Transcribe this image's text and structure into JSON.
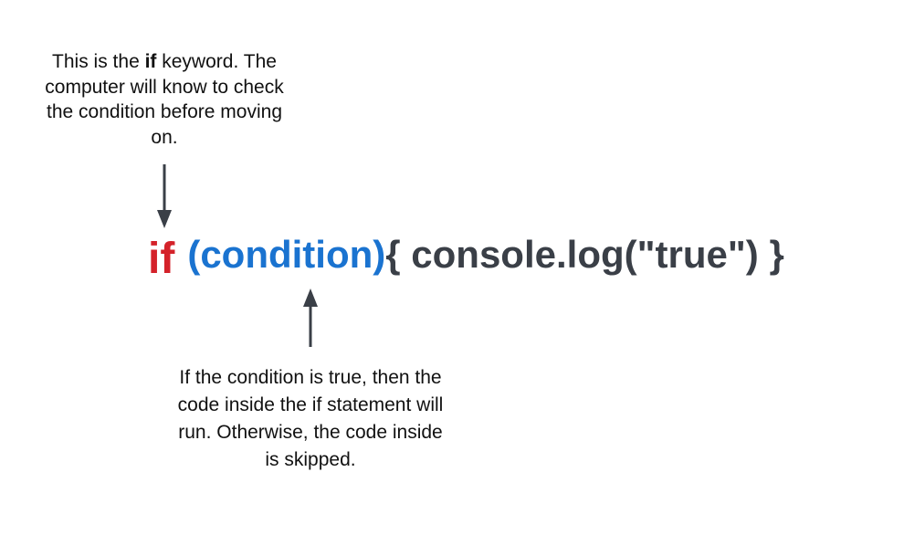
{
  "annotation_top": {
    "before": "This is the ",
    "keyword": "if",
    "after": " keyword. The computer will know to check the condition before moving on."
  },
  "code": {
    "keyword": "if",
    "condition": "(condition)",
    "body": "{ console.log(\"true\") }"
  },
  "annotation_bottom": {
    "text": "If the condition is true, then the code inside the if statement will run. Otherwise, the code inside is skipped."
  },
  "colors": {
    "keyword": "#d4222a",
    "condition": "#1a73d0",
    "code": "#3a3f47",
    "arrow": "#3a3f47"
  }
}
